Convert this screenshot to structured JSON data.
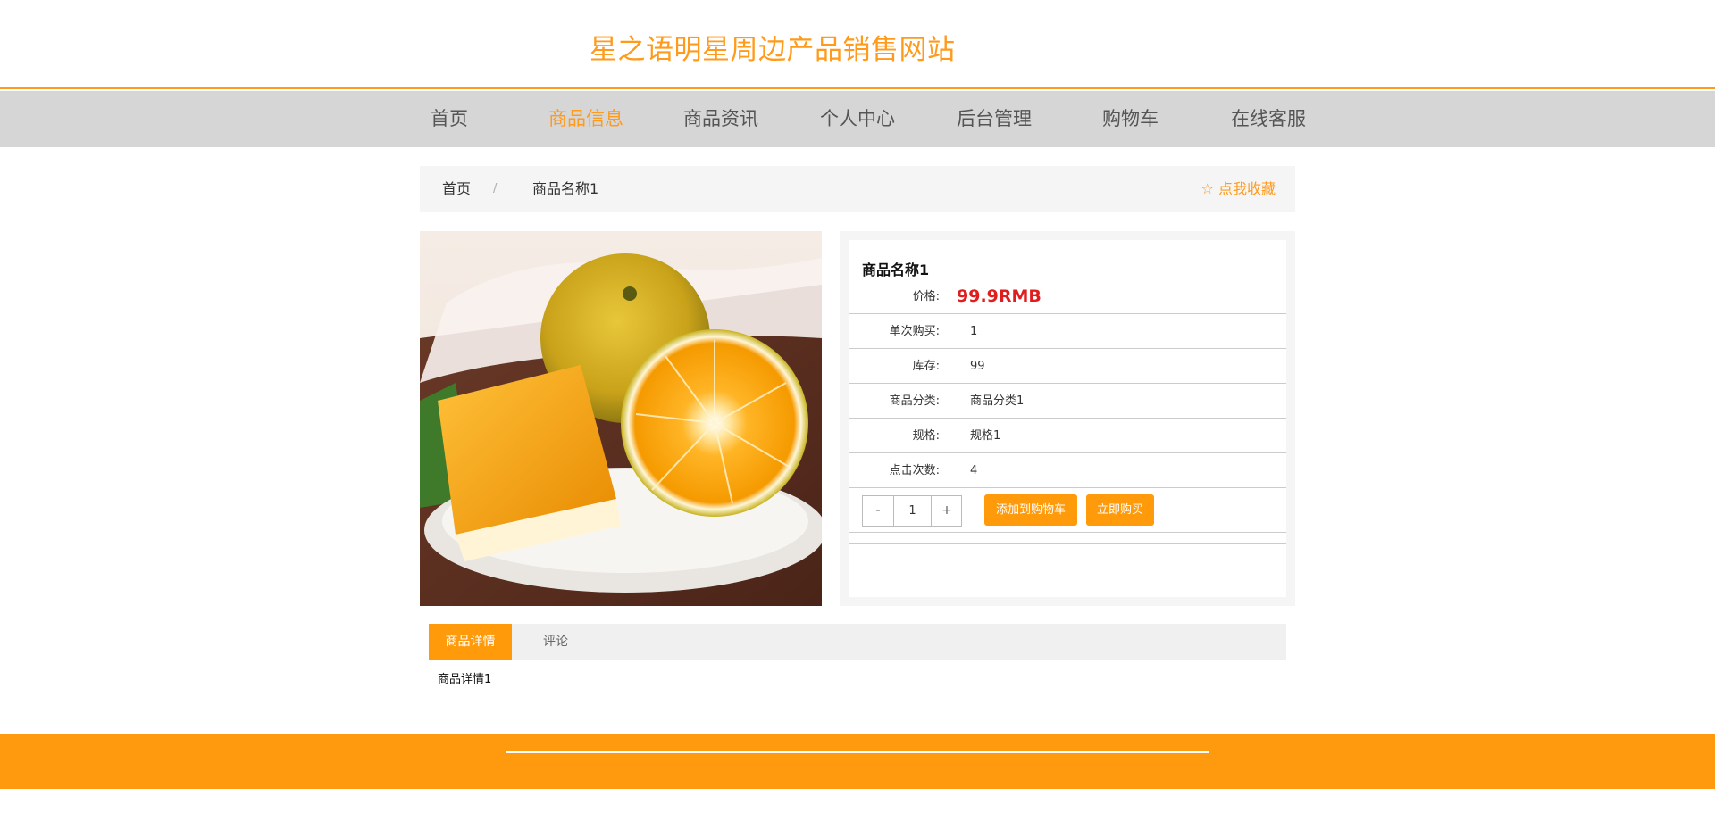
{
  "site": {
    "title": "星之语明星周边产品销售网站"
  },
  "nav": {
    "items": [
      {
        "label": "首页"
      },
      {
        "label": "商品信息"
      },
      {
        "label": "商品资讯"
      },
      {
        "label": "个人中心"
      },
      {
        "label": "后台管理"
      },
      {
        "label": "购物车"
      },
      {
        "label": "在线客服"
      }
    ],
    "active_index": 1
  },
  "breadcrumb": {
    "home": "首页",
    "separator": "/",
    "current": "商品名称1",
    "favorite_icon": "star-outline-icon",
    "favorite": "点我收藏"
  },
  "product": {
    "image_alt": "oranges on a plate",
    "name": "商品名称1",
    "price_label": "价格:",
    "price": "99.9RMB",
    "rows": [
      {
        "label": "单次购买:",
        "value": "1"
      },
      {
        "label": "库存:",
        "value": "99"
      },
      {
        "label": "商品分类:",
        "value": "商品分类1"
      },
      {
        "label": "规格:",
        "value": "规格1"
      },
      {
        "label": "点击次数:",
        "value": "4"
      }
    ],
    "quantity": {
      "minus": "-",
      "value": "1",
      "plus": "+"
    },
    "add_to_cart": "添加到购物车",
    "buy_now": "立即购买"
  },
  "tabs": {
    "items": [
      {
        "label": "商品详情"
      },
      {
        "label": "评论"
      }
    ],
    "active_index": 0,
    "content": "商品详情1"
  },
  "colors": {
    "accent": "#ff9a1a",
    "price": "#e01e1e",
    "nav_bg": "#d6d6d6",
    "footer_bg": "#ff9a0f"
  }
}
